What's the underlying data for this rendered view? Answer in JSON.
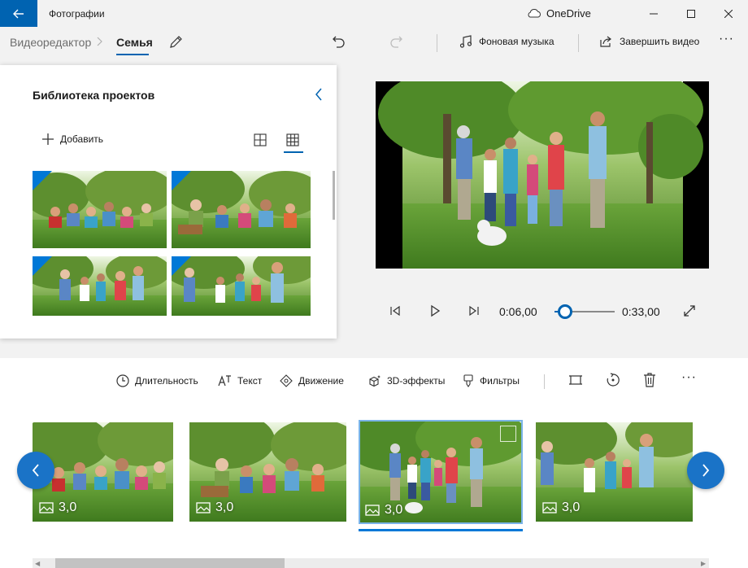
{
  "titlebar": {
    "app_title": "Фотографии",
    "cloud_label": "OneDrive"
  },
  "cmdbar": {
    "breadcrumb_root": "Видеоредактор",
    "breadcrumb_sep": ">",
    "breadcrumb_current": "Семья",
    "music_label": "Фоновая музыка",
    "finish_label": "Завершить видео",
    "more": "···"
  },
  "library": {
    "title": "Библиотека проектов",
    "add_label": "Добавить"
  },
  "player": {
    "current_time": "0:06,00",
    "total_time": "0:33,00",
    "progress": 0.182
  },
  "storyboard": {
    "duration_label": "Длительность",
    "text_label": "Текст",
    "motion_label": "Движение",
    "effects_label": "3D-эффекты",
    "filters_label": "Фильтры",
    "more": "···",
    "cards": [
      {
        "duration": "3,0"
      },
      {
        "duration": "3,0"
      },
      {
        "duration": "3,0"
      },
      {
        "duration": "3,0"
      }
    ]
  },
  "colors": {
    "accent": "#0063b1",
    "nav_button": "#1a73c7"
  }
}
